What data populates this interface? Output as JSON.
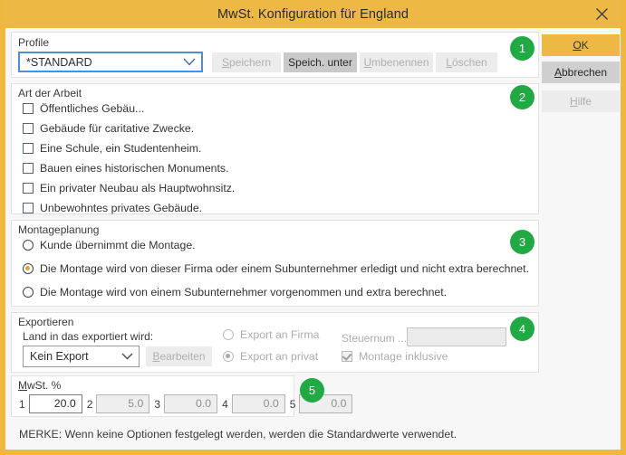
{
  "window": {
    "title": "MwSt. Konfiguration für England",
    "close_icon": "close-icon",
    "accent_color": "#eeb845",
    "badge_color": "#21a944"
  },
  "profile": {
    "legend": "Profile",
    "combo_value": "*STANDARD",
    "buttons": [
      {
        "label": "Speichern",
        "state": "disabled"
      },
      {
        "label": "Speich. unter",
        "state": "active"
      },
      {
        "label": "Umbenennen",
        "state": "disabled"
      },
      {
        "label": "Löschen",
        "state": "disabled"
      }
    ],
    "badge": "1"
  },
  "work_type": {
    "legend": "Art der Arbeit",
    "badge": "2",
    "items": [
      {
        "label": "Öffentliches Gebäu...",
        "checked": false
      },
      {
        "label": "Gebäude für caritative Zwecke.",
        "checked": false
      },
      {
        "label": "Eine Schule, ein Studentenheim.",
        "checked": false
      },
      {
        "label": "Bauen eines historischen Monuments.",
        "checked": false
      },
      {
        "label": "Ein privater Neubau als Hauptwohnsitz.",
        "checked": false
      },
      {
        "label": "Unbewohntes privates Gebäude.",
        "checked": false
      }
    ]
  },
  "assembly": {
    "legend": "Montageplanung",
    "badge": "3",
    "options": [
      {
        "label": "Kunde übernimmt die Montage.",
        "selected": false
      },
      {
        "label": "Die Montage wird von dieser Firma oder einem Subunternehmer erledigt und nicht extra berechnet.",
        "selected": true
      },
      {
        "label": "Die Montage wird von einem Subunternehmer vorgenommen und extra berechnet.",
        "selected": false
      }
    ]
  },
  "export": {
    "legend": "Exportieren",
    "badge": "4",
    "country_label": "Land in das exportiert wird:",
    "country_value": "Kein Export",
    "edit_button": "Bearbeiten",
    "radios": [
      {
        "label": "Export an Firma",
        "selected": false
      },
      {
        "label": "Export an privat",
        "selected": true
      }
    ],
    "tax_label": "Steuernum ...",
    "tax_value": "",
    "assembly_included_label": "Montage inklusive",
    "assembly_included_checked": true
  },
  "vat": {
    "legend": "MwSt. %",
    "badge": "5",
    "fields": [
      {
        "index": "1",
        "value": "20.0",
        "enabled": true
      },
      {
        "index": "2",
        "value": "5.0",
        "enabled": false
      },
      {
        "index": "3",
        "value": "0.0",
        "enabled": false
      },
      {
        "index": "4",
        "value": "0.0",
        "enabled": false
      },
      {
        "index": "5",
        "value": "0.0",
        "enabled": false
      }
    ]
  },
  "note": "MERKE: Wenn keine Optionen festgelegt werden, werden die Standardwerte verwendet.",
  "actions": [
    {
      "label": "OK",
      "style": "primary",
      "accel": "O"
    },
    {
      "label": "Abbrechen",
      "style": "normal",
      "accel": "A"
    },
    {
      "label": "Hilfe",
      "style": "disabled",
      "accel": "H"
    }
  ]
}
